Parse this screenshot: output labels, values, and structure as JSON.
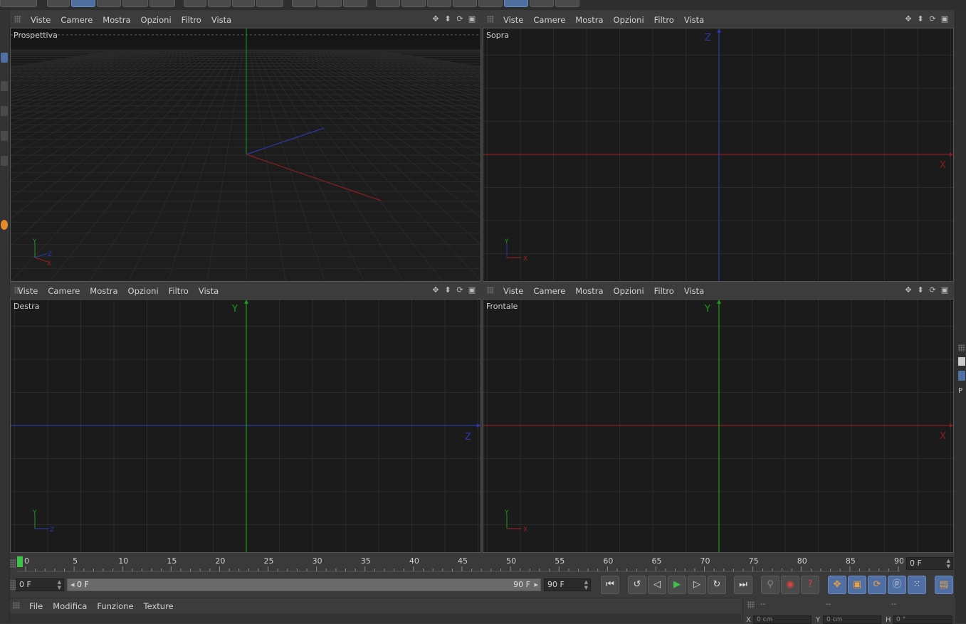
{
  "viewports": [
    {
      "id": "perspective",
      "name": "Prospettiva",
      "menu": [
        "Viste",
        "Camere",
        "Mostra",
        "Opzioni",
        "Filtro",
        "Vista"
      ],
      "axis_labels": [
        "Y",
        "X",
        "Z"
      ]
    },
    {
      "id": "top",
      "name": "Sopra",
      "menu": [
        "Viste",
        "Camere",
        "Mostra",
        "Opzioni",
        "Filtro",
        "Vista"
      ],
      "axis_labels": [
        "Z",
        "X",
        "Y",
        "X"
      ]
    },
    {
      "id": "right",
      "name": "Destra",
      "menu": [
        "Viste",
        "Camere",
        "Mostra",
        "Opzioni",
        "Filtro",
        "Vista"
      ],
      "axis_labels": [
        "Y",
        "Z",
        "Y",
        "Z"
      ]
    },
    {
      "id": "front",
      "name": "Frontale",
      "menu": [
        "Viste",
        "Camere",
        "Mostra",
        "Opzioni",
        "Filtro",
        "Vista"
      ],
      "axis_labels": [
        "Y",
        "X",
        "Y",
        "X"
      ]
    }
  ],
  "viewport_icons": [
    "move-view-icon",
    "zoom-view-icon",
    "rotate-view-icon",
    "maximize-view-icon"
  ],
  "timeline": {
    "ticks": [
      "0",
      "5",
      "10",
      "15",
      "20",
      "25",
      "30",
      "35",
      "40",
      "45",
      "50",
      "55",
      "60",
      "65",
      "70",
      "75",
      "80",
      "85",
      "90"
    ],
    "current_frame": "0 F"
  },
  "transport": {
    "start_field": "0 F",
    "range_start": "0 F",
    "range_end": "90 F",
    "end_field": "90 F"
  },
  "material_menu": [
    "File",
    "Modifica",
    "Funzione",
    "Texture"
  ],
  "coord_panel": {
    "headers": [
      "--",
      "--",
      "--"
    ],
    "row_labels": [
      "X",
      "Y",
      "H"
    ],
    "row_values": [
      "0 cm",
      "0 cm",
      "0 °"
    ]
  },
  "colors": {
    "axis_x": "#a02020",
    "axis_y": "#1f9a1f",
    "axis_z": "#2a3aa8",
    "play": "#3fc24a",
    "accent": "#e58a2a"
  }
}
